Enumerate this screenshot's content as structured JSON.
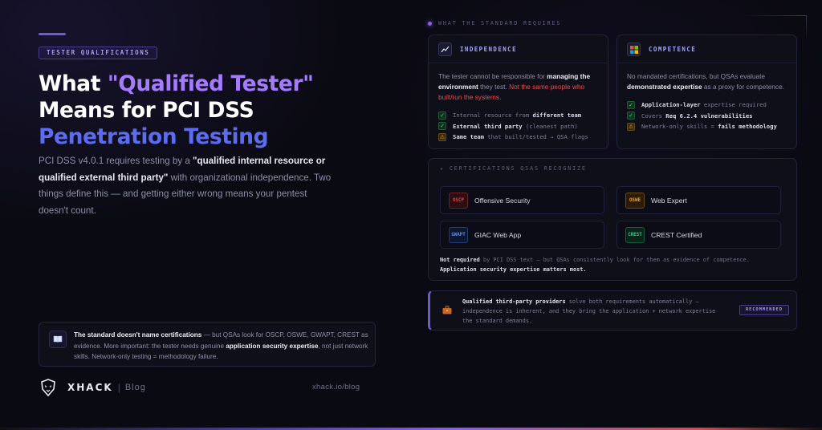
{
  "tag": "TESTER QUALIFICATIONS",
  "headline": {
    "line1_prefix": "What ",
    "line1_highlight": "\"Qualified Tester\"",
    "line2": "Means for PCI DSS",
    "line3": "Penetration Testing"
  },
  "intro": {
    "p1": "PCI DSS v4.0.1 requires testing by a ",
    "strong": "\"qualified internal resource or qualified external third party\"",
    "p2": " with organizational independence. Two things define this — and getting either wrong means your pentest doesn't count."
  },
  "note": {
    "icon": "book-icon",
    "strong1": "The standard doesn't name certifications",
    "t1": " — but QSAs look for OSCP, OSWE, GWAPT, CREST as evidence. More important: the tester needs genuine ",
    "strong2": "application security expertise",
    "t2": ", not just network skills. Network-only testing = methodology failure."
  },
  "brand": {
    "name": "XHACK",
    "sep": "|",
    "blog": "Blog",
    "url": "xhack.io/blog"
  },
  "requirements_head": "WHAT THE STANDARD REQUIRES",
  "independence": {
    "title": "INDEPENDENCE",
    "icon": "chart-icon",
    "desc_t1": "The tester cannot be responsible for ",
    "desc_strong": "managing the environment",
    "desc_t2": " they test. ",
    "desc_red": "Not the same people who built/run the systems.",
    "checks": [
      {
        "status": "ok",
        "pre": "Internal resource from ",
        "strong": "different team",
        "post": ""
      },
      {
        "status": "ok",
        "pre": "",
        "strong": "External third party",
        "post": " (cleanest path)"
      },
      {
        "status": "warn",
        "pre": "",
        "strong": "Same team",
        "post": " that built/tested → QSA flags"
      }
    ]
  },
  "competence": {
    "title": "COMPETENCE",
    "icon": "windows-icon",
    "desc_t1": "No mandated certifications, but QSAs evaluate ",
    "desc_strong": "demonstrated expertise",
    "desc_t2": " as a proxy for competence.",
    "checks": [
      {
        "status": "ok",
        "pre": "",
        "strong": "Application-layer",
        "post": " expertise required"
      },
      {
        "status": "ok",
        "pre": "Covers ",
        "strong": "Req 6.2.4 vulnerabilities",
        "post": ""
      },
      {
        "status": "warn",
        "pre": "Network-only skills = ",
        "strong": "fails methodology",
        "post": ""
      }
    ]
  },
  "certs_head": "CERTIFICATIONS QSAS RECOGNIZE",
  "certs": [
    {
      "badge": "OSCP",
      "name": "Offensive Security",
      "color": "#e0484e"
    },
    {
      "badge": "OSWE",
      "name": "Web Expert",
      "color": "#f0a030"
    },
    {
      "badge": "GWAPT",
      "name": "GIAC Web App",
      "color": "#4a82f0"
    },
    {
      "badge": "CREST",
      "name": "CREST Certified",
      "color": "#30d08a"
    }
  ],
  "certs_foot": {
    "strong1": "Not required",
    "t1": " by PCI DSS text — but QSAs consistently look for them as evidence of competence. ",
    "strong2": "Application security expertise matters most."
  },
  "recommend": {
    "icon": "briefcase-icon",
    "strong": "Qualified third-party providers",
    "text": " solve both requirements automatically — independence is inherent, and they bring the application + network expertise the standard demands.",
    "badge": "RECOMMENDED"
  }
}
